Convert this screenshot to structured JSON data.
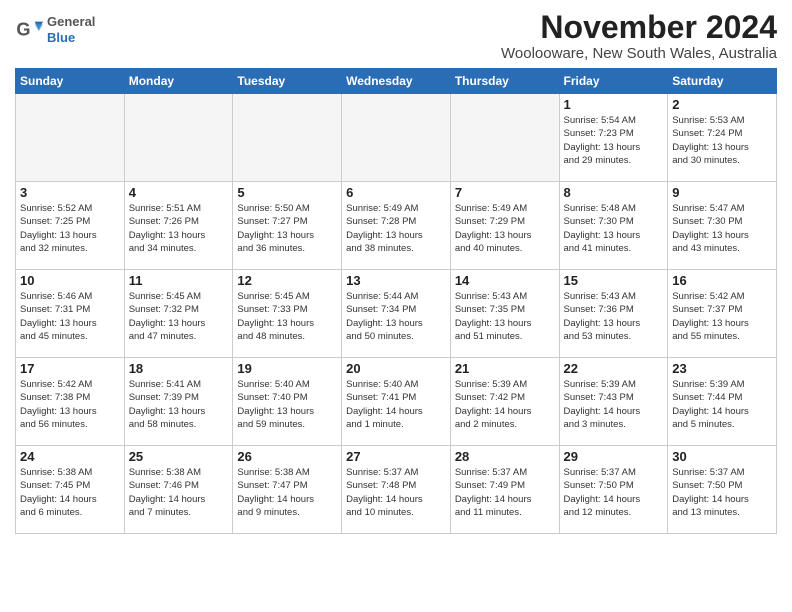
{
  "logo": {
    "general": "General",
    "blue": "Blue"
  },
  "title": "November 2024",
  "location": "Woolooware, New South Wales, Australia",
  "weekdays": [
    "Sunday",
    "Monday",
    "Tuesday",
    "Wednesday",
    "Thursday",
    "Friday",
    "Saturday"
  ],
  "weeks": [
    [
      {
        "day": "",
        "info": ""
      },
      {
        "day": "",
        "info": ""
      },
      {
        "day": "",
        "info": ""
      },
      {
        "day": "",
        "info": ""
      },
      {
        "day": "",
        "info": ""
      },
      {
        "day": "1",
        "info": "Sunrise: 5:54 AM\nSunset: 7:23 PM\nDaylight: 13 hours\nand 29 minutes."
      },
      {
        "day": "2",
        "info": "Sunrise: 5:53 AM\nSunset: 7:24 PM\nDaylight: 13 hours\nand 30 minutes."
      }
    ],
    [
      {
        "day": "3",
        "info": "Sunrise: 5:52 AM\nSunset: 7:25 PM\nDaylight: 13 hours\nand 32 minutes."
      },
      {
        "day": "4",
        "info": "Sunrise: 5:51 AM\nSunset: 7:26 PM\nDaylight: 13 hours\nand 34 minutes."
      },
      {
        "day": "5",
        "info": "Sunrise: 5:50 AM\nSunset: 7:27 PM\nDaylight: 13 hours\nand 36 minutes."
      },
      {
        "day": "6",
        "info": "Sunrise: 5:49 AM\nSunset: 7:28 PM\nDaylight: 13 hours\nand 38 minutes."
      },
      {
        "day": "7",
        "info": "Sunrise: 5:49 AM\nSunset: 7:29 PM\nDaylight: 13 hours\nand 40 minutes."
      },
      {
        "day": "8",
        "info": "Sunrise: 5:48 AM\nSunset: 7:30 PM\nDaylight: 13 hours\nand 41 minutes."
      },
      {
        "day": "9",
        "info": "Sunrise: 5:47 AM\nSunset: 7:30 PM\nDaylight: 13 hours\nand 43 minutes."
      }
    ],
    [
      {
        "day": "10",
        "info": "Sunrise: 5:46 AM\nSunset: 7:31 PM\nDaylight: 13 hours\nand 45 minutes."
      },
      {
        "day": "11",
        "info": "Sunrise: 5:45 AM\nSunset: 7:32 PM\nDaylight: 13 hours\nand 47 minutes."
      },
      {
        "day": "12",
        "info": "Sunrise: 5:45 AM\nSunset: 7:33 PM\nDaylight: 13 hours\nand 48 minutes."
      },
      {
        "day": "13",
        "info": "Sunrise: 5:44 AM\nSunset: 7:34 PM\nDaylight: 13 hours\nand 50 minutes."
      },
      {
        "day": "14",
        "info": "Sunrise: 5:43 AM\nSunset: 7:35 PM\nDaylight: 13 hours\nand 51 minutes."
      },
      {
        "day": "15",
        "info": "Sunrise: 5:43 AM\nSunset: 7:36 PM\nDaylight: 13 hours\nand 53 minutes."
      },
      {
        "day": "16",
        "info": "Sunrise: 5:42 AM\nSunset: 7:37 PM\nDaylight: 13 hours\nand 55 minutes."
      }
    ],
    [
      {
        "day": "17",
        "info": "Sunrise: 5:42 AM\nSunset: 7:38 PM\nDaylight: 13 hours\nand 56 minutes."
      },
      {
        "day": "18",
        "info": "Sunrise: 5:41 AM\nSunset: 7:39 PM\nDaylight: 13 hours\nand 58 minutes."
      },
      {
        "day": "19",
        "info": "Sunrise: 5:40 AM\nSunset: 7:40 PM\nDaylight: 13 hours\nand 59 minutes."
      },
      {
        "day": "20",
        "info": "Sunrise: 5:40 AM\nSunset: 7:41 PM\nDaylight: 14 hours\nand 1 minute."
      },
      {
        "day": "21",
        "info": "Sunrise: 5:39 AM\nSunset: 7:42 PM\nDaylight: 14 hours\nand 2 minutes."
      },
      {
        "day": "22",
        "info": "Sunrise: 5:39 AM\nSunset: 7:43 PM\nDaylight: 14 hours\nand 3 minutes."
      },
      {
        "day": "23",
        "info": "Sunrise: 5:39 AM\nSunset: 7:44 PM\nDaylight: 14 hours\nand 5 minutes."
      }
    ],
    [
      {
        "day": "24",
        "info": "Sunrise: 5:38 AM\nSunset: 7:45 PM\nDaylight: 14 hours\nand 6 minutes."
      },
      {
        "day": "25",
        "info": "Sunrise: 5:38 AM\nSunset: 7:46 PM\nDaylight: 14 hours\nand 7 minutes."
      },
      {
        "day": "26",
        "info": "Sunrise: 5:38 AM\nSunset: 7:47 PM\nDaylight: 14 hours\nand 9 minutes."
      },
      {
        "day": "27",
        "info": "Sunrise: 5:37 AM\nSunset: 7:48 PM\nDaylight: 14 hours\nand 10 minutes."
      },
      {
        "day": "28",
        "info": "Sunrise: 5:37 AM\nSunset: 7:49 PM\nDaylight: 14 hours\nand 11 minutes."
      },
      {
        "day": "29",
        "info": "Sunrise: 5:37 AM\nSunset: 7:50 PM\nDaylight: 14 hours\nand 12 minutes."
      },
      {
        "day": "30",
        "info": "Sunrise: 5:37 AM\nSunset: 7:50 PM\nDaylight: 14 hours\nand 13 minutes."
      }
    ]
  ]
}
